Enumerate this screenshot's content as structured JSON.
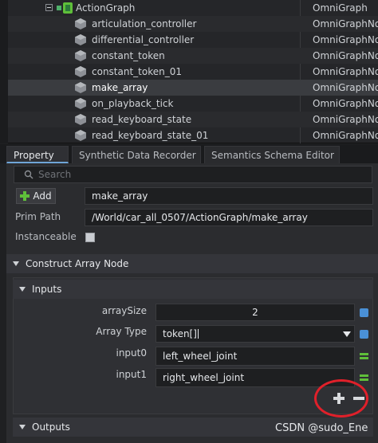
{
  "stage": {
    "graph": {
      "name": "ActionGraph",
      "type": "OmniGraph"
    },
    "rows": [
      {
        "name": "articulation_controller",
        "type": "OmniGraphNode"
      },
      {
        "name": "differential_controller",
        "type": "OmniGraphNode"
      },
      {
        "name": "constant_token",
        "type": "OmniGraphNode"
      },
      {
        "name": "constant_token_01",
        "type": "OmniGraphNode"
      },
      {
        "name": "make_array",
        "type": "OmniGraphNode"
      },
      {
        "name": "on_playback_tick",
        "type": "OmniGraphNode"
      },
      {
        "name": "read_keyboard_state",
        "type": "OmniGraphNode"
      },
      {
        "name": "read_keyboard_state_01",
        "type": "OmniGraphNode"
      }
    ],
    "selected_index": 4
  },
  "tabs": [
    "Property",
    "Synthetic Data Recorder",
    "Semantics Schema Editor"
  ],
  "property": {
    "search_placeholder": "Search",
    "add_label": "Add",
    "name_value": "make_array",
    "prim_path_label": "Prim Path",
    "prim_path_value": "/World/car_all_0507/ActionGraph/make_array",
    "instanceable_label": "Instanceable",
    "section_title": "Construct Array Node",
    "inputs_title": "Inputs",
    "array_size_label": "arraySize",
    "array_size_value": "2",
    "array_type_label": "Array Type",
    "array_type_value": "token[]",
    "input0_label": "input0",
    "input0_value": "left_wheel_joint",
    "input1_label": "input1",
    "input1_value": "right_wheel_joint",
    "outputs_title": "Outputs"
  },
  "watermark": "CSDN @sudo_Ene",
  "colors": {
    "accent": "#4a90d6",
    "highlight": "#e0202a",
    "add_green": "#5fbf3a"
  }
}
